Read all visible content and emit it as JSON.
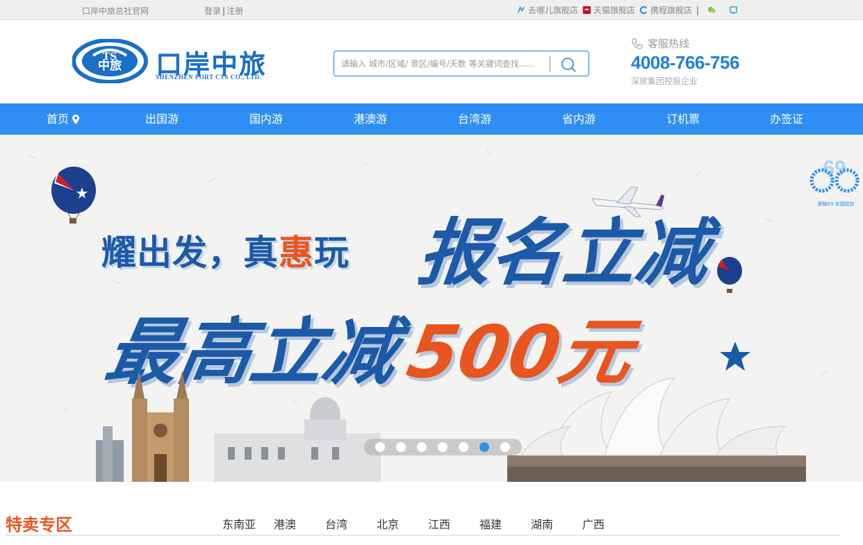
{
  "topbar": {
    "official_site": "口岸中旅总社官网",
    "login": "登录",
    "sep": "|",
    "register": "注册",
    "shops": [
      {
        "label": "去哪儿旗舰店",
        "icon": "qunar-icon"
      },
      {
        "label": "天猫旗舰店",
        "icon": "tmall-icon"
      },
      {
        "label": "携程旗舰店",
        "icon": "ctrip-icon"
      }
    ],
    "bar": "|",
    "social_icons": [
      "wechat-icon",
      "weibo-icon"
    ]
  },
  "header": {
    "logo_cn": "口岸中旅",
    "logo_en": "SHENZHEN PORT CTS CO., LTD.",
    "logo_mark": "中旅",
    "search_placeholder": "请输入 城市/区域/ 景区/编号/天数 等关键词查找......",
    "hotline_label": "客服热线",
    "hotline_number": "4008-766-756",
    "hotline_sub": "深旅集团控股企业"
  },
  "nav": {
    "items": [
      {
        "label": "首页"
      },
      {
        "label": "出国游"
      },
      {
        "label": "国内游"
      },
      {
        "label": "港澳游"
      },
      {
        "label": "台湾游"
      },
      {
        "label": "省内游"
      },
      {
        "label": "订机票"
      },
      {
        "label": "办签证"
      }
    ]
  },
  "banner": {
    "line1_a": "耀出发，真",
    "line1_hl": "惠",
    "line1_b": "玩",
    "headline1": "报名立减",
    "headline2": "最高立减",
    "amount": "500元",
    "badge_number": "69",
    "badge_text": "荣耀69 幸福绽放",
    "slide_count": 7,
    "active_slide": 6
  },
  "special": {
    "title": "特卖专区",
    "tabs": [
      "东南亚",
      "港澳",
      "台湾",
      "北京",
      "江西",
      "福建",
      "湖南",
      "广西"
    ]
  },
  "colors": {
    "brand_blue": "#2f8ef3",
    "accent_orange": "#e8551e",
    "banner_blue": "#1c5aa8"
  }
}
